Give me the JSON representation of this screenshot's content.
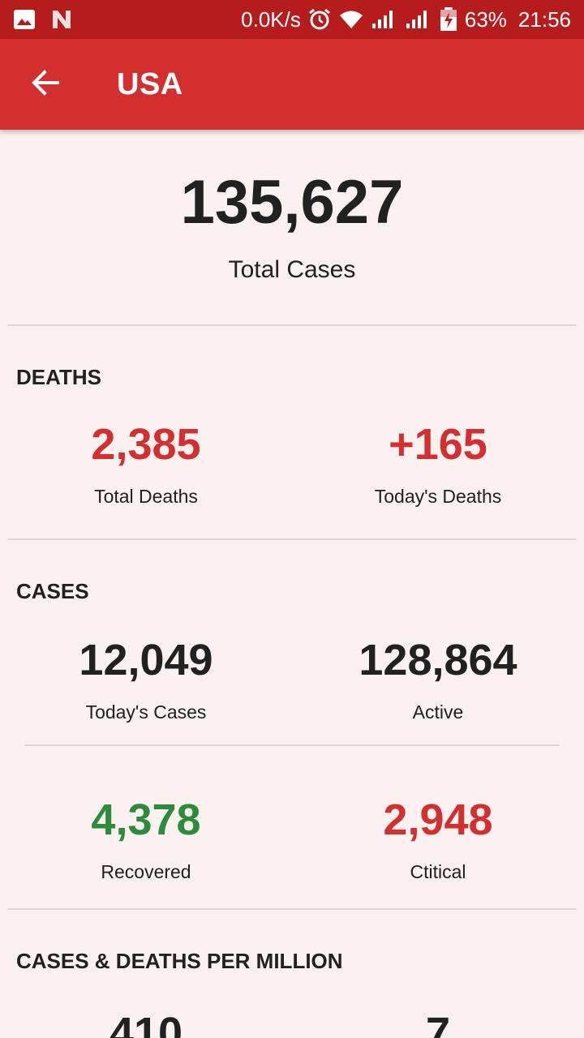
{
  "status_bar": {
    "net_speed": "0.0K/s",
    "battery": "63%",
    "time": "21:56",
    "icons": [
      "image-icon",
      "n-app-icon",
      "alarm-icon",
      "wifi-icon",
      "signal-icon",
      "signal-icon",
      "battery-charging-icon"
    ]
  },
  "app_bar": {
    "title": "USA",
    "back_icon": "arrow-back-icon"
  },
  "summary": {
    "total_cases": "135,627",
    "total_cases_label": "Total Cases"
  },
  "deaths": {
    "title": "DEATHS",
    "total_value": "2,385",
    "total_label": "Total Deaths",
    "today_value": "+165",
    "today_label": "Today's Deaths"
  },
  "cases": {
    "title": "CASES",
    "today_value": "12,049",
    "today_label": "Today's Cases",
    "active_value": "128,864",
    "active_label": "Active",
    "recovered_value": "4,378",
    "recovered_label": "Recovered",
    "critical_value": "2,948",
    "critical_label": "Ctitical"
  },
  "per_million": {
    "title": "CASES & DEATHS PER MILLION",
    "cases_value": "410",
    "deaths_value": "7"
  },
  "colors": {
    "status_bar": "#b71c1c",
    "app_bar": "#d32f2f",
    "red": "#d32f2f",
    "green": "#2e8b3a",
    "background": "#fbf1f1"
  }
}
